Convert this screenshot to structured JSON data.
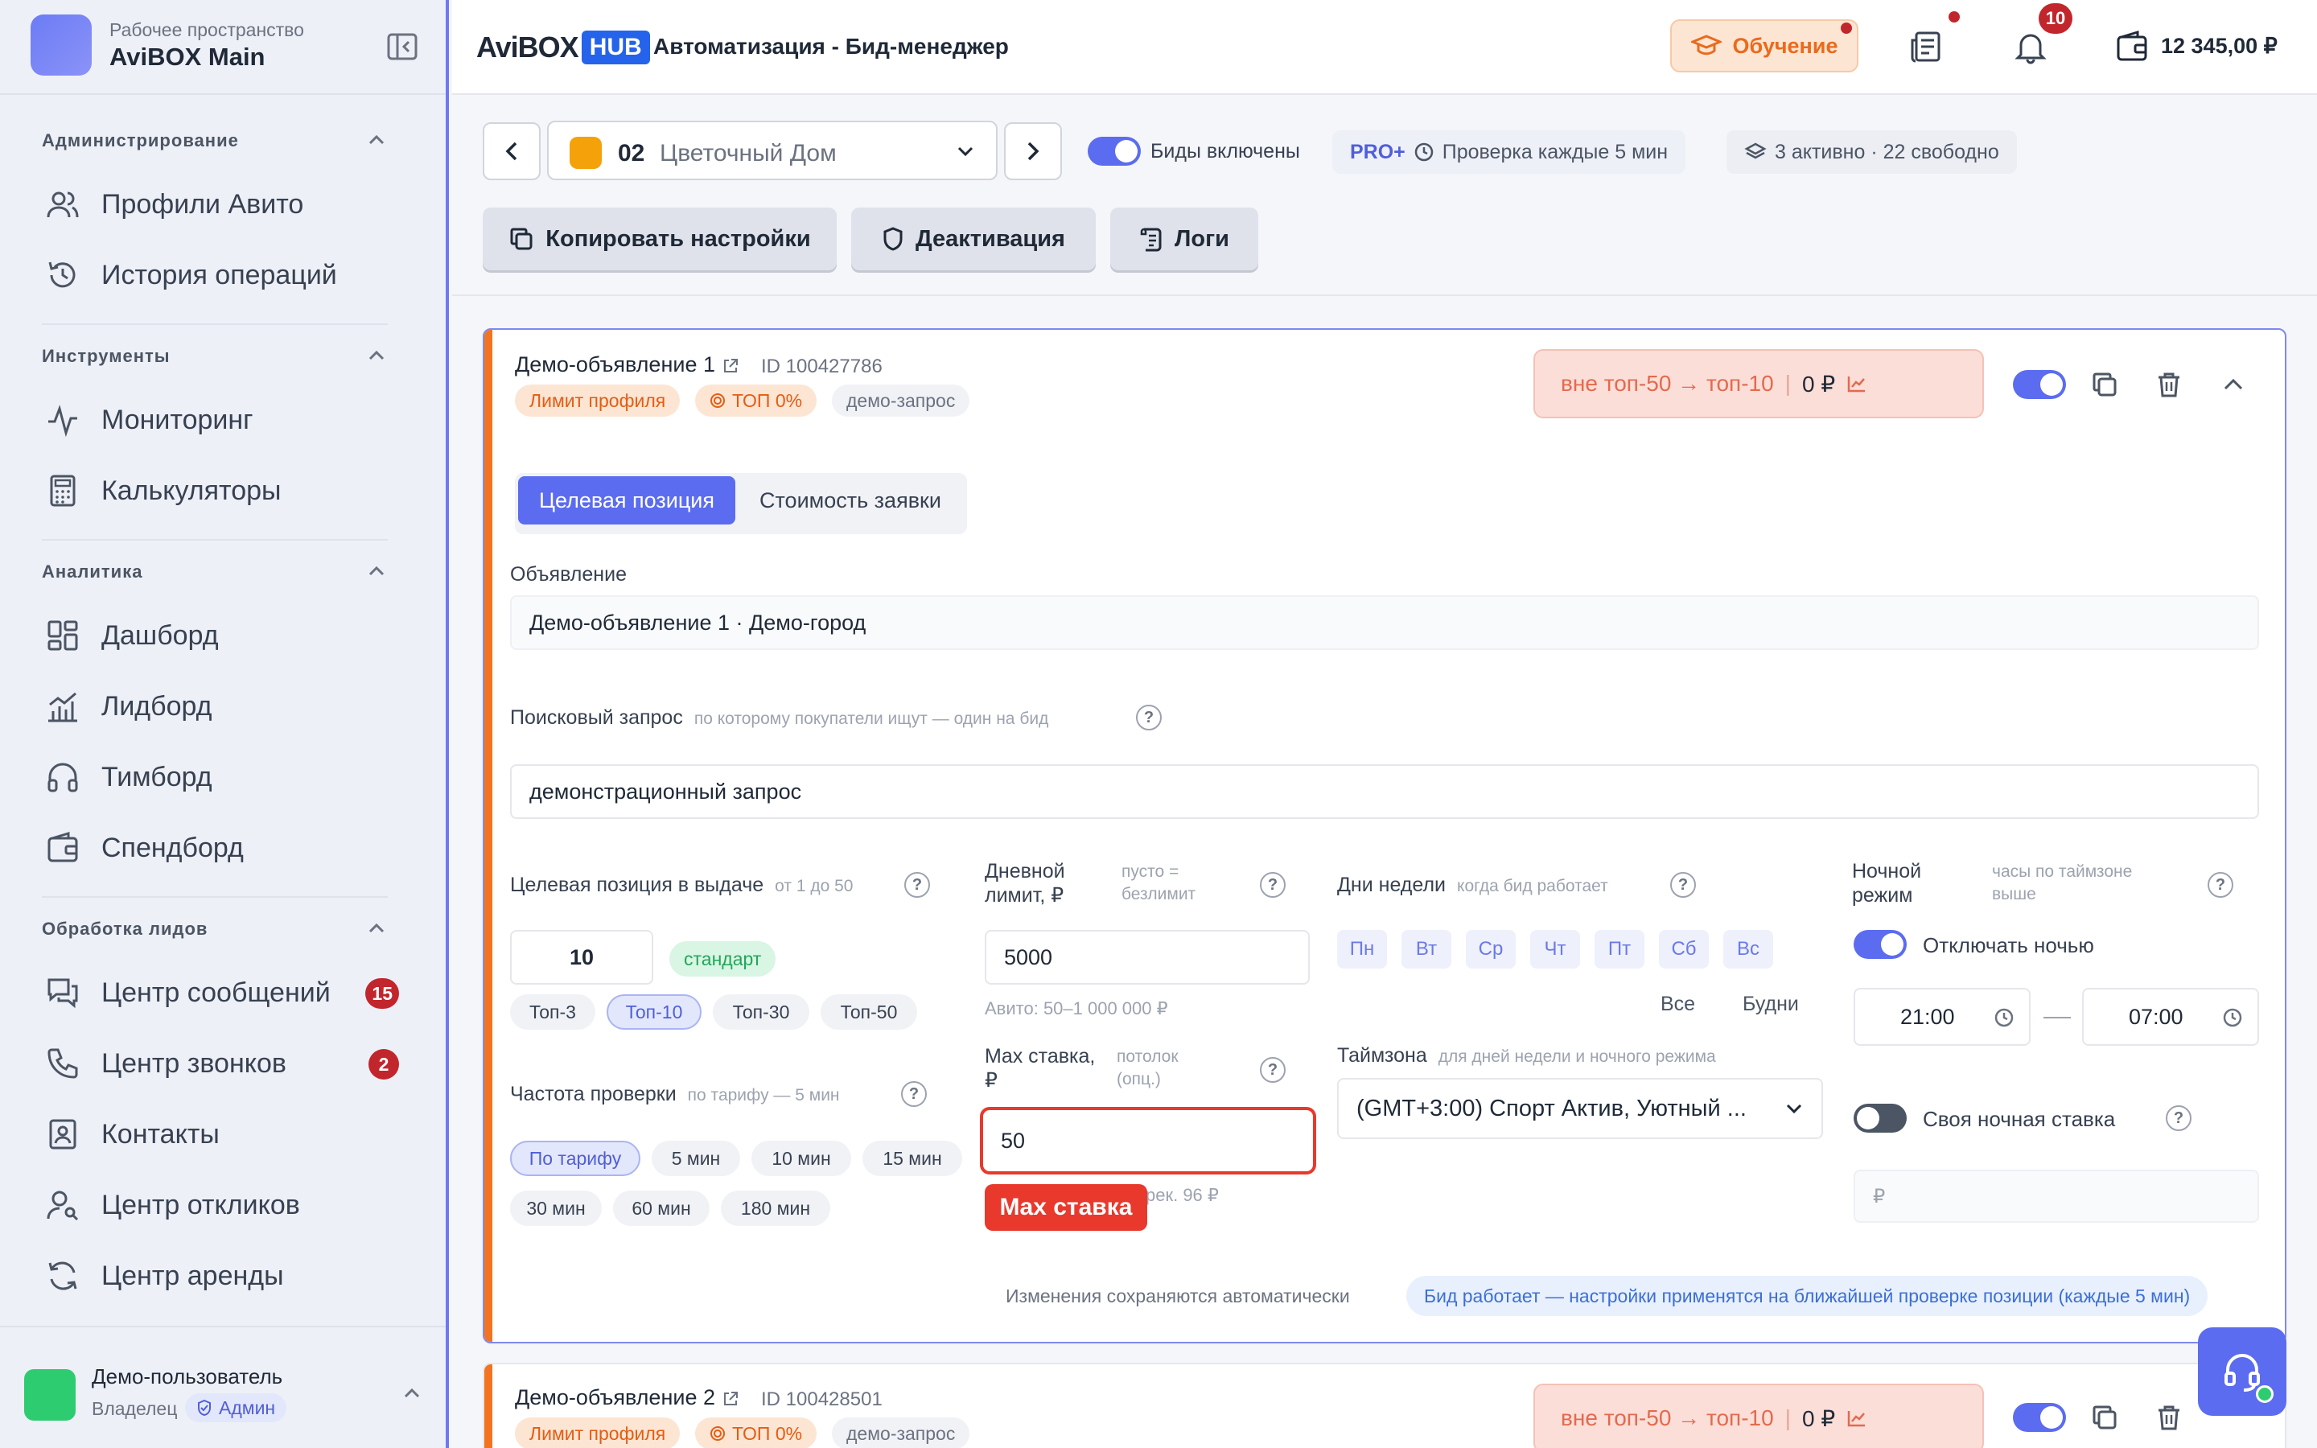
{
  "workspace": {
    "subtitle": "Рабочее пространство",
    "name": "AviBOX Main"
  },
  "sidebar": {
    "sections": [
      {
        "title": "Администрирование",
        "items": [
          {
            "label": "Профили Авито",
            "icon": "users-icon"
          },
          {
            "label": "История операций",
            "icon": "history-icon"
          }
        ]
      },
      {
        "title": "Инструменты",
        "items": [
          {
            "label": "Мониторинг",
            "icon": "activity-icon"
          },
          {
            "label": "Калькуляторы",
            "icon": "calculator-icon"
          }
        ]
      },
      {
        "title": "Аналитика",
        "items": [
          {
            "label": "Дашборд",
            "icon": "dashboard-icon"
          },
          {
            "label": "Лидборд",
            "icon": "chart-icon"
          },
          {
            "label": "Тимборд",
            "icon": "headphones-icon"
          },
          {
            "label": "Спендборд",
            "icon": "wallet-icon"
          }
        ]
      },
      {
        "title": "Обработка лидов",
        "items": [
          {
            "label": "Центр сообщений",
            "icon": "messages-icon",
            "count": "15"
          },
          {
            "label": "Центр звонков",
            "icon": "phone-icon",
            "count": "2"
          },
          {
            "label": "Контакты",
            "icon": "contacts-icon"
          },
          {
            "label": "Центр откликов",
            "icon": "user-search-icon"
          },
          {
            "label": "Центр аренды",
            "icon": "refresh-icon"
          }
        ]
      }
    ],
    "user": {
      "name": "Демо-пользователь",
      "role": "Владелец",
      "badge": "Админ"
    }
  },
  "header": {
    "brand": "AviBOX",
    "brand_hub": "HUB",
    "title": "Автоматизация - Бид-менеджер",
    "learn_label": "Обучение",
    "notifications_count": "10",
    "balance": "12 345,00 ₽"
  },
  "toolbar": {
    "account_num": "02",
    "account_name": "Цветочный Дом",
    "bids_label": "Биды включены",
    "plan": "PRO+",
    "check_label": "Проверка каждые 5 мин",
    "slots": "3 активно · 22 свободно",
    "copy_label": "Копировать настройки",
    "deactivate_label": "Деактивация",
    "logs_label": "Логи"
  },
  "card1": {
    "title": "Демо-объявление 1",
    "id": "ID 100427786",
    "tags": [
      "Лимит профиля",
      "ТОП 0%",
      "демо-запрос"
    ],
    "position": "вне топ-50 → топ-10",
    "cost": "0 ₽",
    "tabs": [
      "Целевая позиция",
      "Стоимость заявки"
    ],
    "ad_label": "Объявление",
    "ad_value": "Демо-объявление 1 · Демо-город",
    "query_label": "Поисковый запрос",
    "query_hint": "по которому покупатели ищут — один на бид",
    "query_value": "демонстрационный запрос",
    "target_label": "Целевая позиция в выдаче",
    "target_hint": "от 1 до 50",
    "target_value": "10",
    "target_badge": "стандарт",
    "target_chips": [
      "Топ-3",
      "Топ-10",
      "Топ-30",
      "Топ-50"
    ],
    "freq_label": "Частота проверки",
    "freq_hint": "по тарифу — 5 мин",
    "freq_chips": [
      "По тарифу",
      "5 мин",
      "10 мин",
      "15 мин",
      "30 мин",
      "60 мин",
      "180 мин"
    ],
    "daily_label_1": "Дневной",
    "daily_label_2": "лимит, ₽",
    "daily_hint_1": "пусто =",
    "daily_hint_2": "безлимит",
    "daily_value": "5000",
    "daily_note": "Авито: 50–1 000 000 ₽",
    "max_label_1": "Max ставка,",
    "max_label_2": "₽",
    "max_hint_1": "потолок",
    "max_hint_2": "(опц.)",
    "max_value": "50",
    "max_note": "рек. 96 ₽",
    "max_tooltip": "Max ставка",
    "days_label": "Дни недели",
    "days_hint": "когда бид работает",
    "days": [
      "Пн",
      "Вт",
      "Ср",
      "Чт",
      "Пт",
      "Сб",
      "Вс"
    ],
    "days_all": "Все",
    "days_weekdays": "Будни",
    "tz_label": "Таймзона",
    "tz_hint": "для дней недели и ночного режима",
    "tz_value": "(GMT+3:00) Спорт Актив, Уютный ...",
    "night_label_1": "Ночной",
    "night_label_2": "режим",
    "night_hint_1": "часы по таймзоне",
    "night_hint_2": "выше",
    "night_toggle_label": "Отключать ночью",
    "night_from": "21:00",
    "night_to": "07:00",
    "night_bid_label": "Своя ночная ставка",
    "night_bid_placeholder": "₽",
    "autosave": "Изменения сохраняются автоматически",
    "info": "Бид работает — настройки применятся на ближайшей проверке позиции (каждые 5 мин)"
  },
  "card2": {
    "title": "Демо-объявление 2",
    "id": "ID 100428501",
    "tags": [
      "Лимит профиля",
      "ТОП 0%",
      "демо-запрос"
    ],
    "position": "вне топ-50 → топ-10",
    "cost": "0 ₽"
  },
  "colors": {
    "accent": "#5b6cf0",
    "orange": "#f27420",
    "danger": "#e8392c",
    "badge": "#c2262d"
  }
}
